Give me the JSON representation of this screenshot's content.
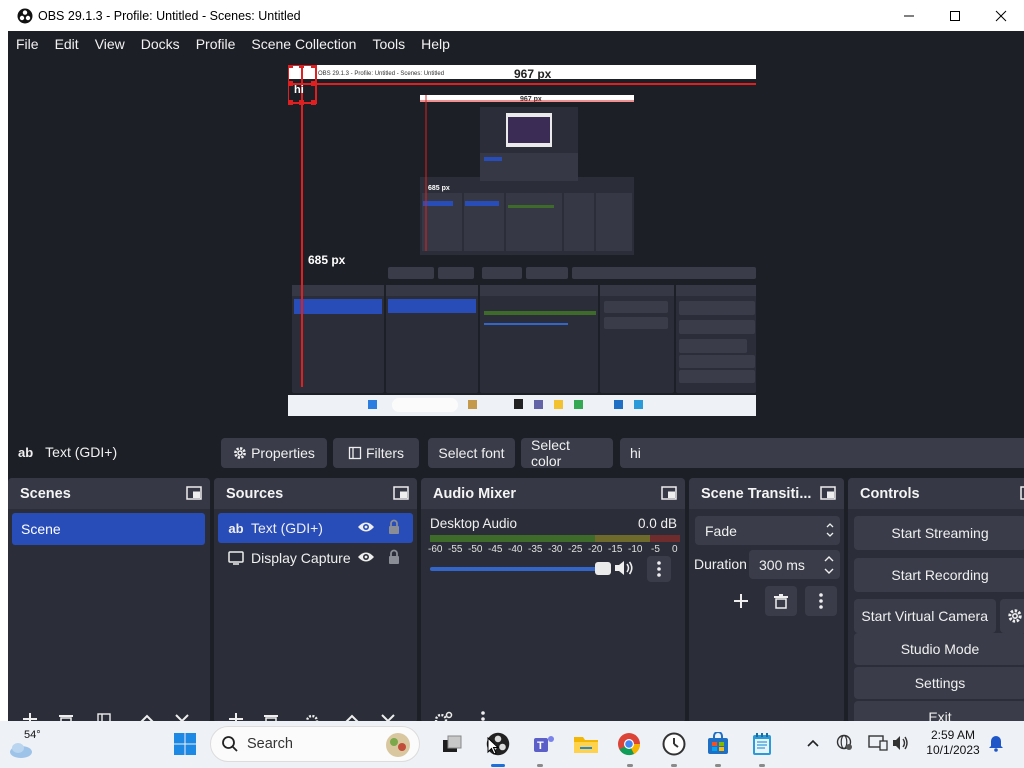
{
  "window": {
    "title": "OBS 29.1.3 - Profile: Untitled - Scenes: Untitled"
  },
  "menu": [
    "File",
    "Edit",
    "View",
    "Docks",
    "Profile",
    "Scene Collection",
    "Tools",
    "Help"
  ],
  "preview": {
    "inner_title": "OBS 29.1.3 - Profile: Untitled - Scenes: Untitled",
    "width_label": "967 px",
    "height_label": "685 px",
    "nested_width_label": "967 px",
    "nested_height_label": "685 px"
  },
  "context_bar": {
    "source_icon": "ab",
    "source_name": "Text (GDI+)",
    "properties_label": "Properties",
    "filters_label": "Filters",
    "select_font_label": "Select font",
    "select_color_label": "Select color",
    "text_value": "hi"
  },
  "scenes": {
    "title": "Scenes",
    "items": [
      "Scene"
    ]
  },
  "sources": {
    "title": "Sources",
    "items": [
      {
        "name": "Text (GDI+)",
        "icon": "ab"
      },
      {
        "name": "Display Capture",
        "icon": "monitor-icon"
      }
    ]
  },
  "audio_mixer": {
    "title": "Audio Mixer",
    "channel": "Desktop Audio",
    "level": "0.0 dB",
    "ticks": [
      "-60",
      "-55",
      "-50",
      "-45",
      "-40",
      "-35",
      "-30",
      "-25",
      "-20",
      "-15",
      "-10",
      "-5",
      "0"
    ],
    "volume": 1.0
  },
  "transitions": {
    "title": "Scene Transiti...",
    "selected": "Fade",
    "duration_label": "Duration",
    "duration_value": "300 ms"
  },
  "controls": {
    "title": "Controls",
    "start_streaming": "Start Streaming",
    "start_recording": "Start Recording",
    "start_virtual_camera": "Start Virtual Camera",
    "studio_mode": "Studio Mode",
    "settings": "Settings",
    "exit": "Exit"
  },
  "taskbar": {
    "weather": "54°",
    "search_placeholder": "Search",
    "time": "2:59 AM",
    "date": "10/1/2023"
  },
  "colors": {
    "accent": "#284cb8",
    "bg": "#1d1f26",
    "dock_bg": "#2b2e38",
    "dock_header": "#363945",
    "button": "#3a3d49",
    "selection_red": "#e02020"
  }
}
